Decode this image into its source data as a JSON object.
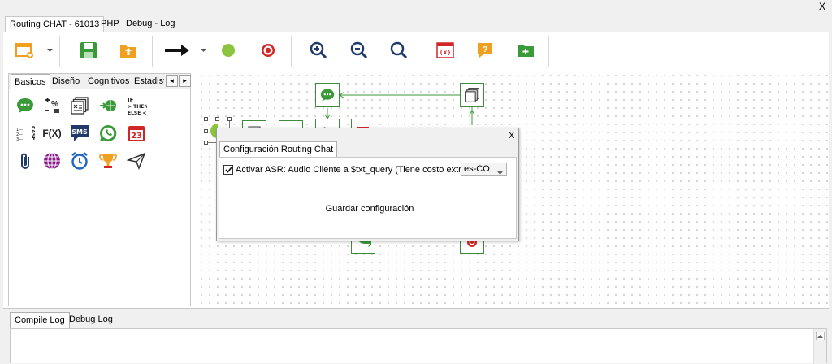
{
  "window": {
    "close_label": "X"
  },
  "tabs": [
    {
      "label": "Routing CHAT - 61013"
    },
    {
      "label": "PHP"
    },
    {
      "label": "Debug - Log"
    }
  ],
  "toolbar": {
    "icons": [
      "new-file-icon",
      "dropdown-arrow-icon",
      "save-icon",
      "upload-icon",
      "arrow-right-icon",
      "green-dot-icon",
      "target-icon",
      "zoom-in-icon",
      "zoom-out-icon",
      "zoom-fit-icon",
      "variable-icon",
      "question-icon",
      "folder-add-icon"
    ]
  },
  "palette": {
    "tabs": [
      "Basicos",
      "Diseño",
      "Cognitivos",
      "Estadist"
    ],
    "scroll_left": "◂",
    "scroll_right": "▸",
    "icons": [
      "chat-message-icon",
      "math-ops-icon",
      "stack-pages-icon",
      "globe-link-icon",
      "if-then-else-icon",
      "case-list-icon",
      "function-fx-icon",
      "sms-icon",
      "whatsapp-icon",
      "calendar-icon",
      "paperclip-icon",
      "web-globe-icon",
      "alarm-clock-icon",
      "trophy-icon",
      "send-plane-icon"
    ],
    "fx_label": "F(X)",
    "sms_label": "SMS",
    "calendar_label": "23",
    "case_label": "CASE",
    "if_lines": [
      "IF",
      "> THEN",
      "ELSE <"
    ],
    "math_label": "+%−="
  },
  "dialog": {
    "close_label": "X",
    "tab_label": "Configuración Routing Chat",
    "asr_checkbox_label": "Activar ASR: Audio Cliente a $txt_query (Tiene costo extra)",
    "asr_checked": true,
    "language_value": "es-CO",
    "save_label": "Guardar configuración"
  },
  "bottom": {
    "tabs": [
      "Compile Log",
      "Debug Log"
    ]
  },
  "colors": {
    "accent_green": "#3a9a3a",
    "red": "#d12626",
    "dark_blue": "#1f3a6b",
    "orange": "#f0a020"
  }
}
